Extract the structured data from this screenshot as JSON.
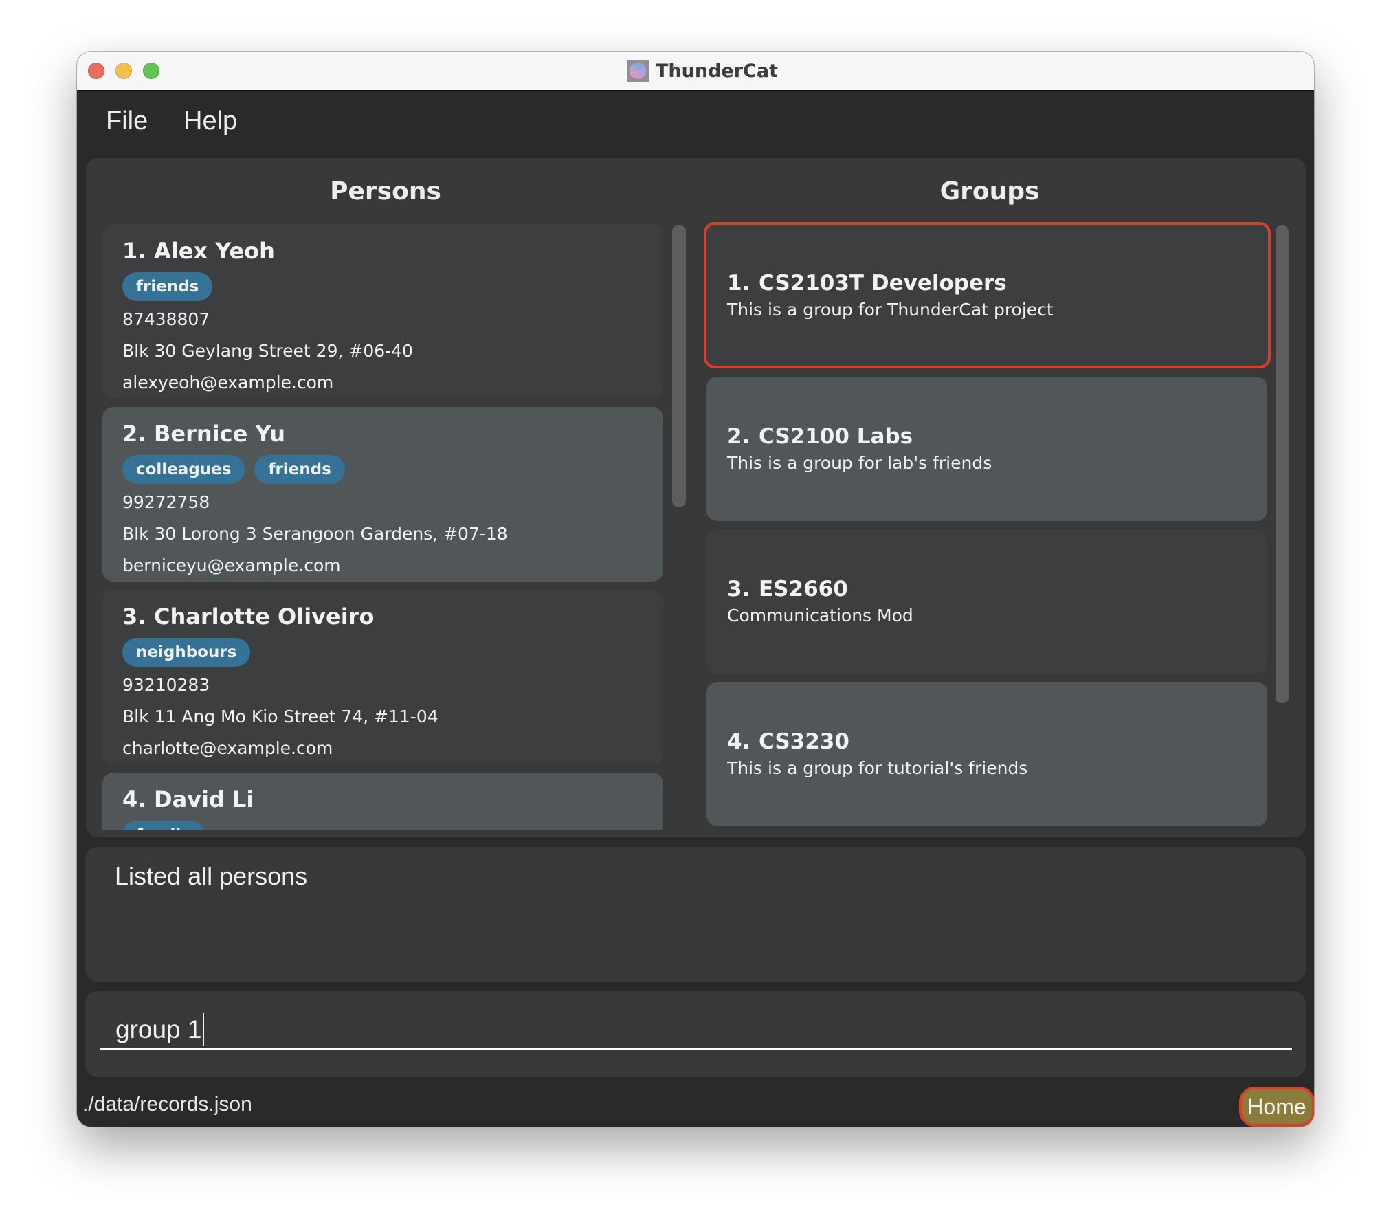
{
  "window": {
    "title": "ThunderCat",
    "app_icon": "thundercat-app-icon"
  },
  "menu": {
    "items": [
      {
        "label": "File"
      },
      {
        "label": "Help"
      }
    ]
  },
  "persons": {
    "heading": "Persons",
    "items": [
      {
        "index": "1.",
        "name": "Alex Yeoh",
        "tags": [
          "friends"
        ],
        "phone": "87438807",
        "address": "Blk 30 Geylang Street 29, #06-40",
        "email": "alexyeoh@example.com"
      },
      {
        "index": "2.",
        "name": "Bernice Yu",
        "tags": [
          "colleagues",
          "friends"
        ],
        "phone": "99272758",
        "address": "Blk 30 Lorong 3 Serangoon Gardens, #07-18",
        "email": "berniceyu@example.com"
      },
      {
        "index": "3.",
        "name": "Charlotte Oliveiro",
        "tags": [
          "neighbours"
        ],
        "phone": "93210283",
        "address": "Blk 11 Ang Mo Kio Street 74, #11-04",
        "email": "charlotte@example.com"
      },
      {
        "index": "4.",
        "name": "David Li",
        "tags": [
          "family"
        ],
        "phone": "",
        "address": "",
        "email": ""
      }
    ]
  },
  "groups": {
    "heading": "Groups",
    "selected_index": 0,
    "items": [
      {
        "index": "1.",
        "name": "CS2103T Developers",
        "description": "This is a group for ThunderCat project"
      },
      {
        "index": "2.",
        "name": "CS2100 Labs",
        "description": "This is a group for lab's friends"
      },
      {
        "index": "3.",
        "name": "ES2660",
        "description": "Communications Mod"
      },
      {
        "index": "4.",
        "name": "CS3230",
        "description": "This is a group for  tutorial's friends"
      }
    ]
  },
  "result": {
    "message": "Listed all persons"
  },
  "command": {
    "value": "group 1",
    "placeholder": ""
  },
  "status": {
    "file_path": "./data/records.json",
    "view_badge": "Home"
  },
  "colors": {
    "tag": "#357296",
    "selected_border": "#d4402a",
    "home_badge": "#8b7c3b"
  }
}
